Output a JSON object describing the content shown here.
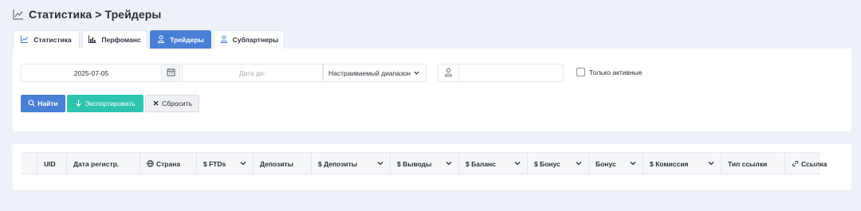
{
  "header": {
    "title": "Статистика > Трейдеры",
    "icon": "line-chart-icon"
  },
  "tabs": [
    {
      "label": "Статистика",
      "icon": "line-chart-icon",
      "active": false
    },
    {
      "label": "Перфоманс",
      "icon": "bar-chart-icon",
      "active": false
    },
    {
      "label": "Трейдеры",
      "icon": "user-icon",
      "active": true
    },
    {
      "label": "Субпартнеры",
      "icon": "user-icon",
      "active": false
    }
  ],
  "filters": {
    "date_from": "2025-07-05",
    "date_to_placeholder": "Дата до:",
    "range_select": "Настраиваемый диапазон",
    "user_input_value": "",
    "only_active_label": "Только активные"
  },
  "buttons": {
    "search": "Найти",
    "export": "Экспортировать",
    "reset": "Сбросить"
  },
  "table": {
    "columns": [
      {
        "label": ""
      },
      {
        "label": "UID"
      },
      {
        "label": "Дата регистр."
      },
      {
        "label": "Страна"
      },
      {
        "label": "$ FTDs"
      },
      {
        "label": "Депозиты"
      },
      {
        "label": "$ Депозиты"
      },
      {
        "label": "$ Выводы"
      },
      {
        "label": "$ Баланс"
      },
      {
        "label": "$ Бонус"
      },
      {
        "label": "Бонус"
      },
      {
        "label": "$ Комиссия"
      },
      {
        "label": "Тип ссылки"
      },
      {
        "label": "Ссылка"
      }
    ]
  },
  "colors": {
    "accent": "#4a7fd6",
    "export": "#2ec4ad",
    "background": "#eef1f7"
  }
}
